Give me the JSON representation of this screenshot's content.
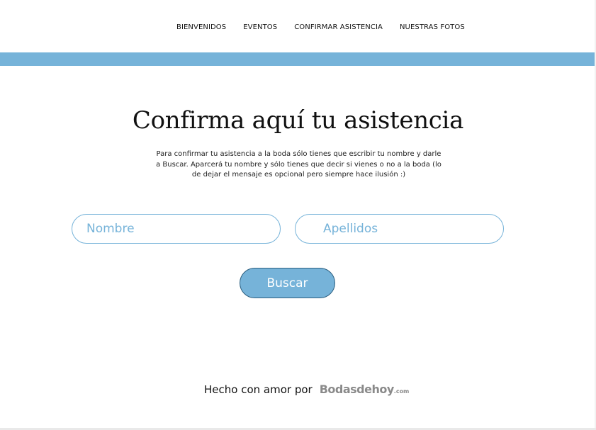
{
  "nav": {
    "items": [
      {
        "label": "BIENVENIDOS"
      },
      {
        "label": "EVENTOS"
      },
      {
        "label": "CONFIRMAR ASISTENCIA"
      },
      {
        "label": "NUESTRAS FOTOS"
      }
    ]
  },
  "colors": {
    "accent": "#76b3d9",
    "button_border": "#2c5f80",
    "text": "#111111",
    "brand_gray": "#8a8a8a"
  },
  "main": {
    "title": "Confirma aquí tu asistencia",
    "description": "Para confirmar tu asistencia a la boda sólo tienes que escribir tu nombre y darle a Buscar. Aparcerá tu nombre y sólo tienes que decir si vienes o no a la boda (lo de dejar el mensaje es opcional pero siempre hace ilusión :)"
  },
  "form": {
    "nombre_placeholder": "Nombre",
    "apellidos_placeholder": "Apellidos",
    "search_button_label": "Buscar"
  },
  "footer": {
    "text": "Hecho con amor por",
    "brand_name": "Bodasdehoy",
    "brand_suffix": ".com"
  }
}
